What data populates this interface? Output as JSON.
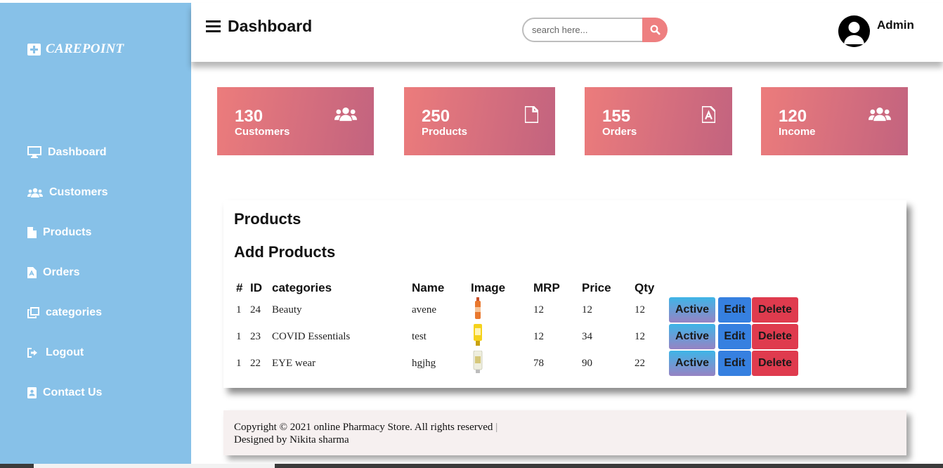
{
  "brand": {
    "name": "CAREPOINT"
  },
  "sidebar": {
    "items": [
      {
        "label": "Dashboard",
        "icon": "monitor-icon"
      },
      {
        "label": "Customers",
        "icon": "users-icon"
      },
      {
        "label": "Products",
        "icon": "file-icon"
      },
      {
        "label": "Orders",
        "icon": "file-pdf-icon"
      },
      {
        "label": "categories",
        "icon": "clone-icon"
      },
      {
        "label": "Logout",
        "icon": "sign-out-icon"
      },
      {
        "label": "Contact Us",
        "icon": "address-book-icon"
      }
    ]
  },
  "header": {
    "title": "Dashboard",
    "search_placeholder": "search here...",
    "user_name": "Admin"
  },
  "stats": [
    {
      "value": "130",
      "label": "Customers",
      "icon": "users-icon"
    },
    {
      "value": "250",
      "label": "Products",
      "icon": "file-icon"
    },
    {
      "value": "155",
      "label": "Orders",
      "icon": "file-pdf-icon"
    },
    {
      "value": "120",
      "label": "Income",
      "icon": "users-icon"
    }
  ],
  "products_panel": {
    "title": "Products",
    "add_label": "Add Products",
    "columns": [
      "#",
      "ID",
      "categories",
      "Name",
      "Image",
      "MRP",
      "Price",
      "Qty"
    ],
    "rows": [
      {
        "num": "1",
        "id": "24",
        "category": "Beauty",
        "name": "avene",
        "image": "orange-bottle",
        "mrp": "12",
        "price": "12",
        "qty": "12"
      },
      {
        "num": "1",
        "id": "23",
        "category": "COVID Essentials",
        "name": "test",
        "image": "yellow-tube",
        "mrp": "12",
        "price": "34",
        "qty": "12"
      },
      {
        "num": "1",
        "id": "22",
        "category": "EYE wear",
        "name": "hgjhg",
        "image": "cream-tube",
        "mrp": "78",
        "price": "90",
        "qty": "22"
      }
    ],
    "actions": {
      "active": "Active",
      "edit": "Edit",
      "delete": "Delete"
    }
  },
  "footer": {
    "copyright": "Copyright © 2021 online Pharmacy Store. All rights reserved",
    "separator": "|",
    "designer": "Designed by Nikita sharma"
  },
  "colors": {
    "sidebar": "#87c1e8",
    "card_start": "#ec7c7c",
    "card_end": "#c2637f",
    "search_button": "#ee7f80",
    "edit_button": "#3680e0",
    "delete_button": "#df3b4e"
  }
}
